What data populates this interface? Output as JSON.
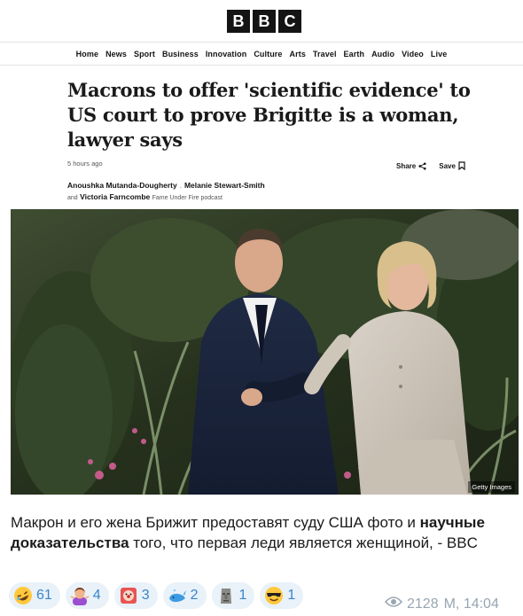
{
  "header": {
    "logo_letters": [
      "B",
      "B",
      "C"
    ]
  },
  "nav": {
    "items": [
      "Home",
      "News",
      "Sport",
      "Business",
      "Innovation",
      "Culture",
      "Arts",
      "Travel",
      "Earth",
      "Audio",
      "Video",
      "Live"
    ]
  },
  "article": {
    "headline": "Macrons to offer 'scientific evidence' to US court to prove Brigitte is a woman, lawyer says",
    "timestamp": "5 hours ago",
    "share_label": "Share",
    "save_label": "Save",
    "authors": {
      "author1": "Anoushka Mutanda-Dougherty",
      "author2": "Melanie Stewart-Smith",
      "and_word": "and",
      "author3": "Victoria Farncombe",
      "author3_role": "Fame Under Fire podcast"
    },
    "image_credit": "Getty Images"
  },
  "post": {
    "caption_part1": "Макрон и его жена Брижит предоставят суду США фото и ",
    "caption_bold": "научные доказательства",
    "caption_part2": " того, что первая леди является женщиной, - BBC",
    "views": "2128",
    "time": "M, 14:04"
  },
  "reactions": [
    {
      "emoji": "rofl-emoji",
      "count": "61"
    },
    {
      "emoji": "woman-shrugging-emoji",
      "count": "4"
    },
    {
      "emoji": "clown-sticker-emoji",
      "count": "3"
    },
    {
      "emoji": "whale-emoji",
      "count": "2"
    },
    {
      "emoji": "moai-emoji",
      "count": "1"
    },
    {
      "emoji": "sunglasses-emoji",
      "count": "1"
    }
  ],
  "colors": {
    "link_blue": "#3a86c8",
    "chip_bg": "#e9f1f9",
    "meta_gray": "#98a5b1"
  }
}
